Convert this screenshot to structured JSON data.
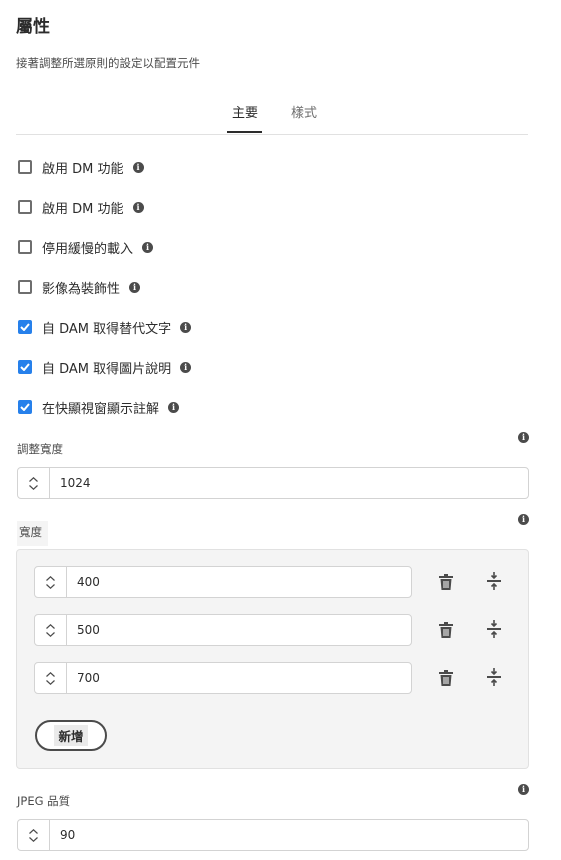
{
  "header": {
    "title": "屬性",
    "subtitle": "接著調整所選原則的設定以配置元件"
  },
  "tabs": [
    {
      "label": "主要",
      "active": true
    },
    {
      "label": "樣式",
      "active": false
    }
  ],
  "checkboxes": [
    {
      "label": "啟用 DM 功能",
      "checked": false
    },
    {
      "label": "啟用 DM 功能",
      "checked": false
    },
    {
      "label": "停用緩慢的載入",
      "checked": false
    },
    {
      "label": "影像為裝飾性",
      "checked": false
    },
    {
      "label": "自 DAM 取得替代文字",
      "checked": true
    },
    {
      "label": "自 DAM 取得圖片說明",
      "checked": true
    },
    {
      "label": "在快顯視窗顯示註解",
      "checked": true
    }
  ],
  "resize_width": {
    "label": "調整寬度",
    "value": "1024"
  },
  "widths": {
    "label": "寬度",
    "items": [
      {
        "value": "400"
      },
      {
        "value": "500"
      },
      {
        "value": "700"
      }
    ],
    "add_label": "新增"
  },
  "jpeg_quality": {
    "label": "JPEG 品質",
    "value": "90"
  },
  "icons": {
    "info": "info-icon",
    "delete": "trash-icon",
    "reorder": "drag-handle-icon",
    "stepper": "chevron-up-down-icon"
  },
  "colors": {
    "checkbox_checked": "#2680eb",
    "text": "#2c2c2c",
    "panel_bg": "#f4f4f4"
  }
}
